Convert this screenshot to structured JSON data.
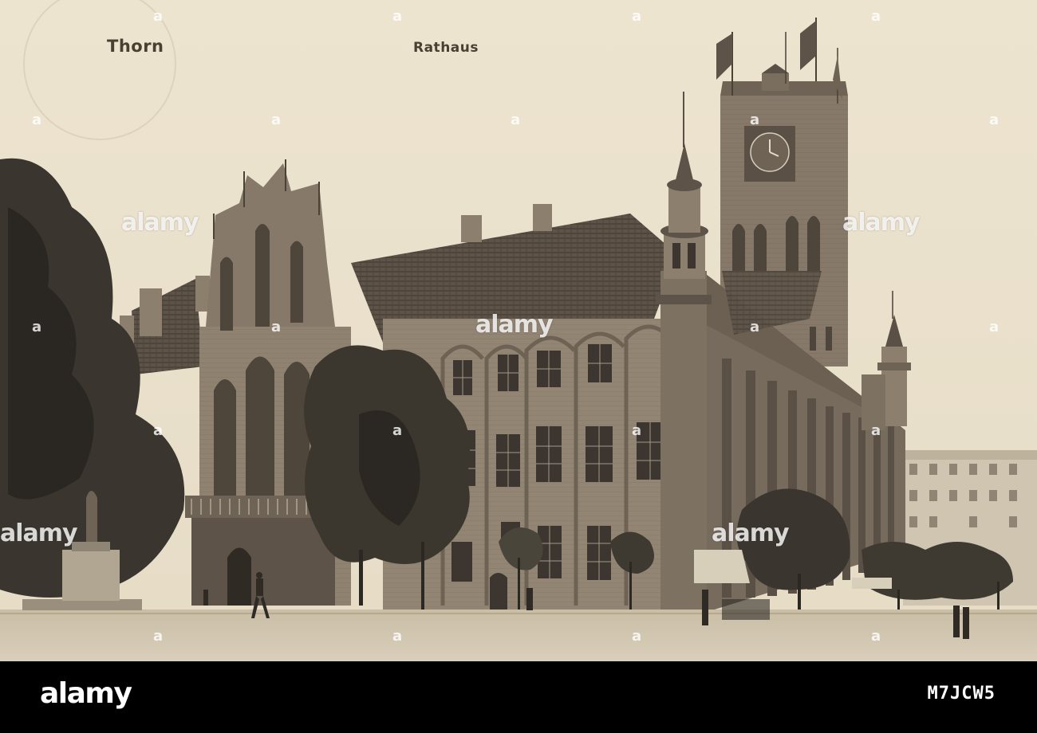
{
  "postcard": {
    "caption_city": "Thorn",
    "caption_subject": "Rathaus"
  },
  "watermark": {
    "text": "alamy",
    "marker": "a"
  },
  "footer": {
    "logo": "alamy",
    "image_code": "M7JCW5"
  },
  "colors": {
    "paper": "#ece3cf",
    "ink": "#4a3f33",
    "footer_bg": "#000000"
  }
}
